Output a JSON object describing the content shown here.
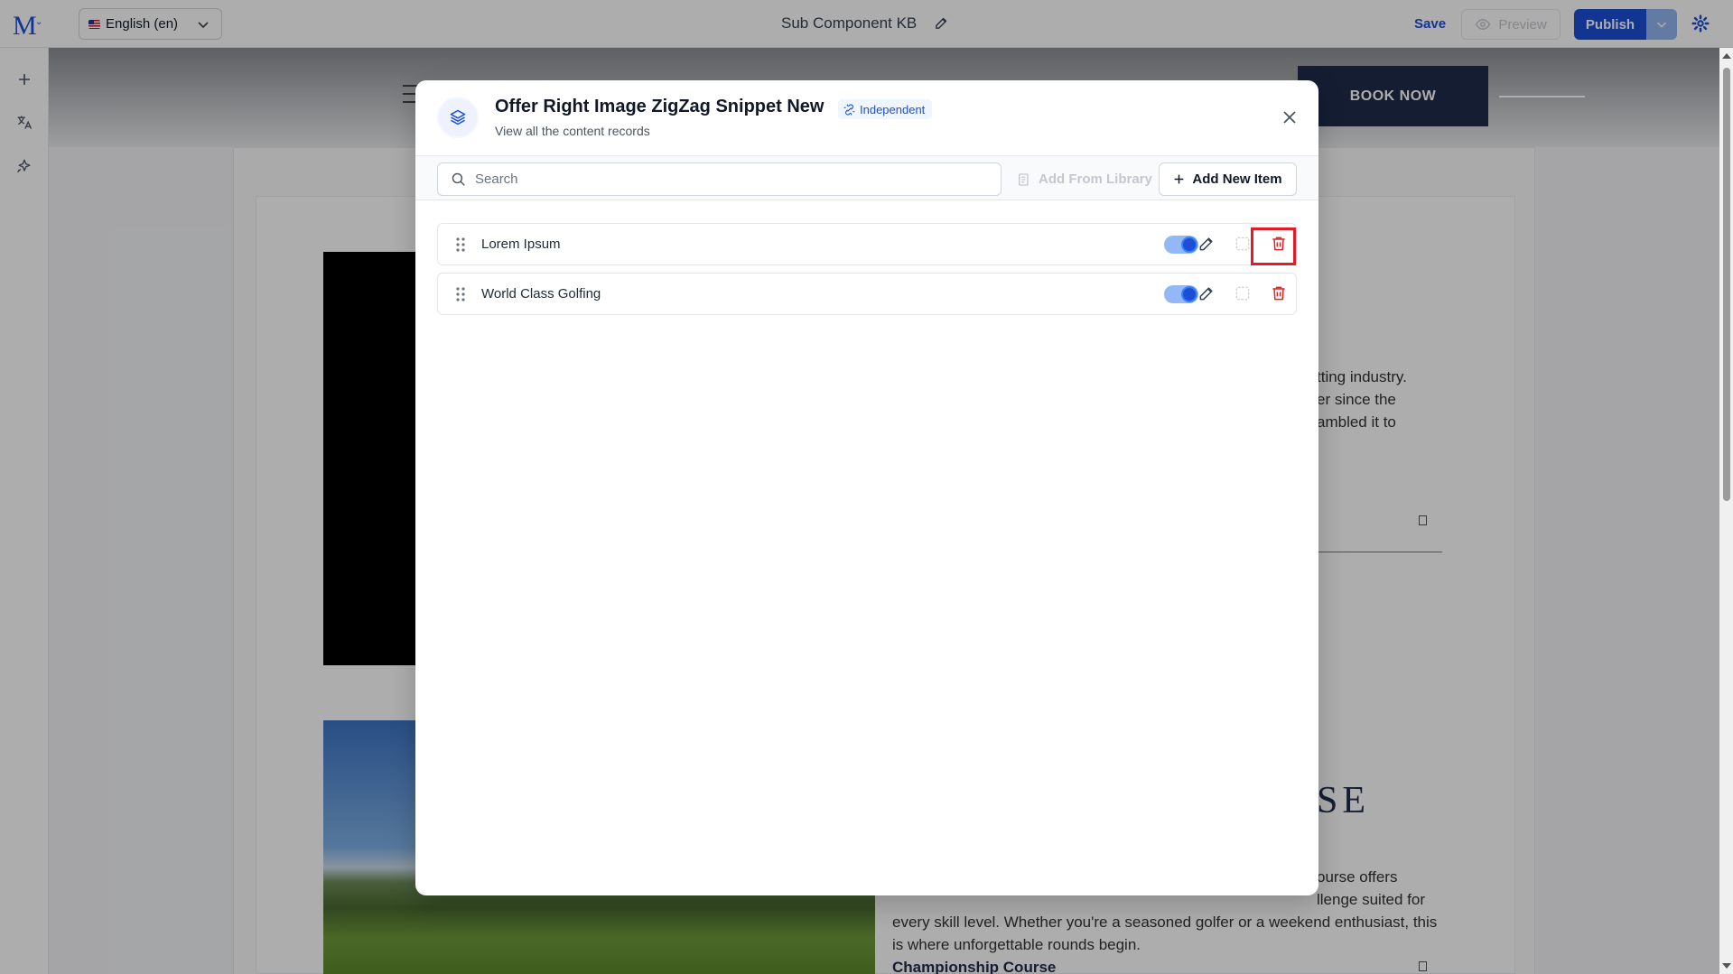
{
  "topbar": {
    "logo": "M",
    "language": "English (en)",
    "doc_title": "Sub Component KB",
    "save_label": "Save",
    "preview_label": "Preview",
    "publish_label": "Publish"
  },
  "background_page": {
    "book_now": "BOOK NOW",
    "text_lines_1": [
      "tting industry.",
      "er since the",
      "ambled it to"
    ],
    "heading_partial": "SE",
    "text_lines_2": [
      "ourse offers",
      "llenge suited for",
      "every skill level. Whether you're a seasoned golfer or a weekend enthusiast, this",
      "is where unforgettable rounds begin."
    ],
    "subheading": "Championship Course"
  },
  "modal": {
    "title": "Offer Right Image ZigZag Snippet New",
    "badge": "Independent",
    "subtitle": "View all the content records",
    "search_placeholder": "Search",
    "add_from_library": "Add From Library",
    "add_new_item": "Add New Item",
    "items": [
      {
        "label": "Lorem Ipsum",
        "enabled": true
      },
      {
        "label": "World Class Golfing",
        "enabled": true
      }
    ]
  },
  "colors": {
    "accent": "#1d4ed8",
    "delete": "#dc2626",
    "highlight": "#e11d2a",
    "navy": "#1e2b4a"
  }
}
